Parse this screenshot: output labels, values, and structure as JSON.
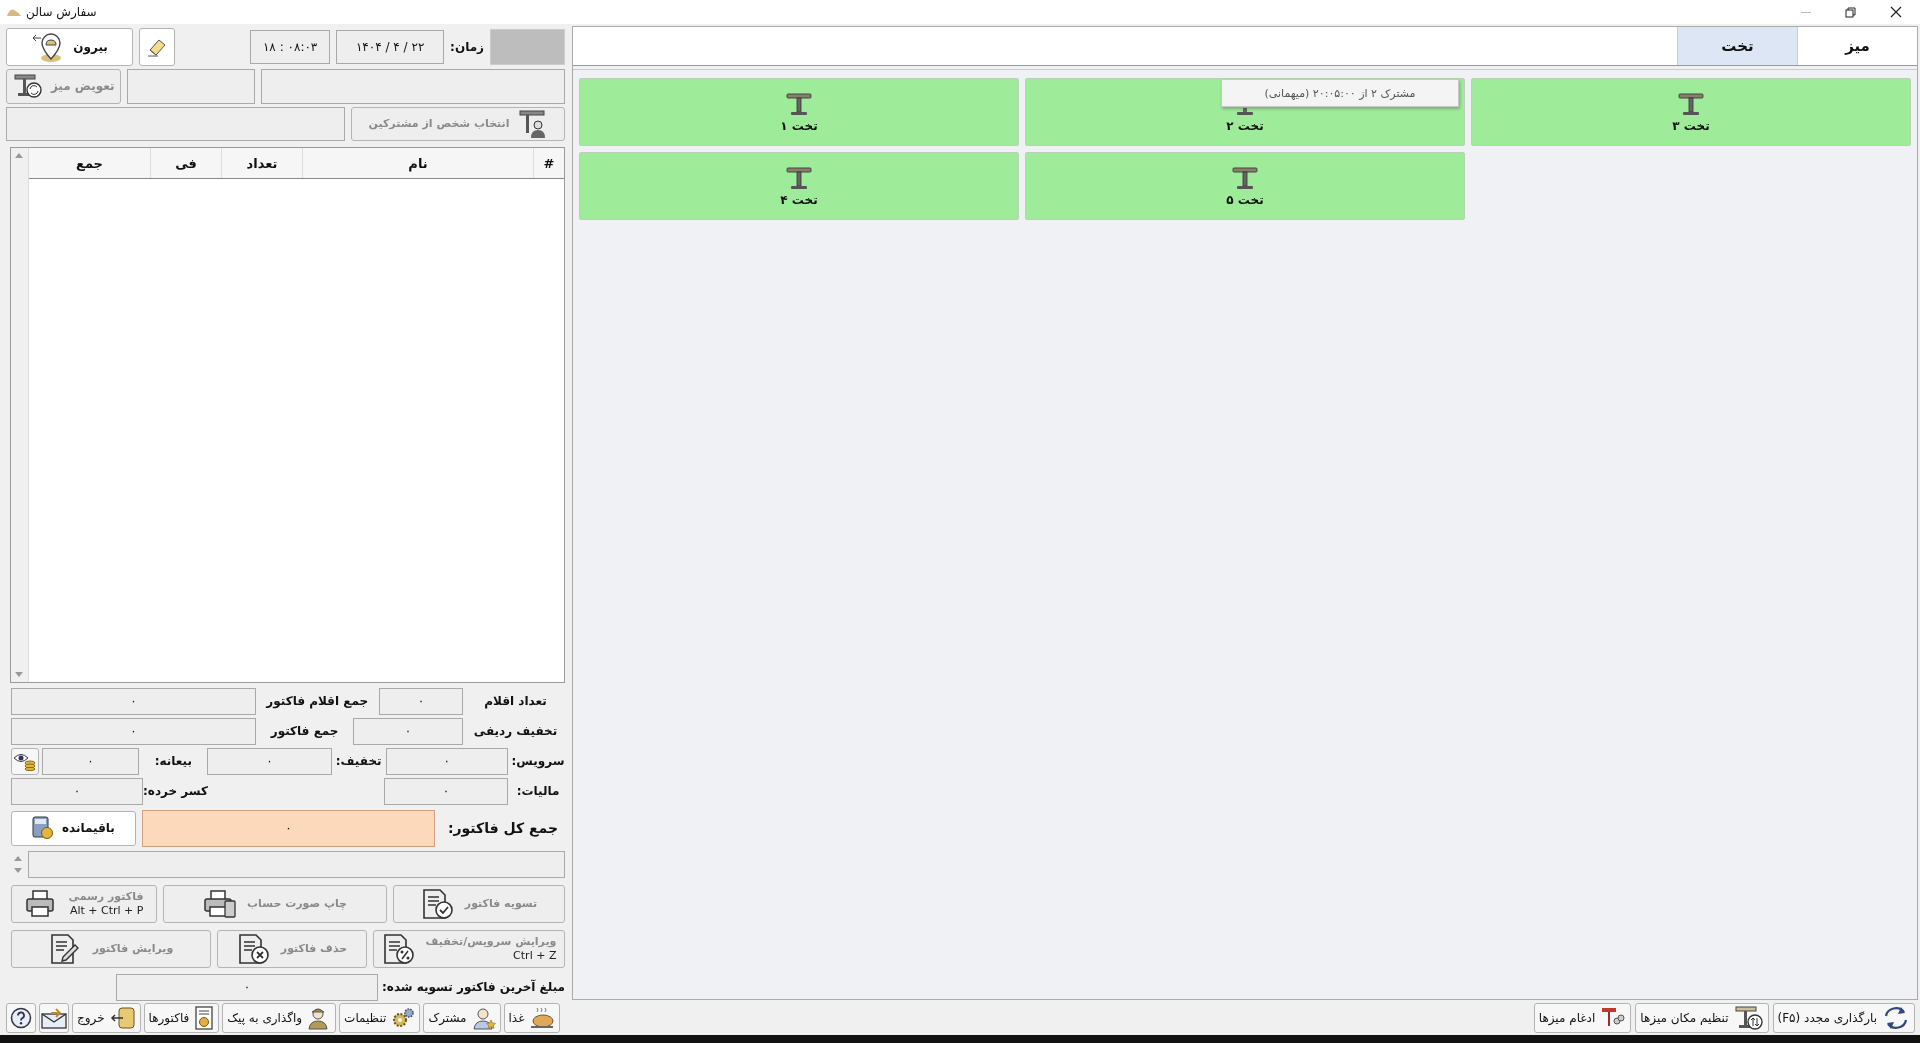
{
  "window": {
    "title": "سفارش سالن"
  },
  "header": {
    "out_button": {
      "label": "بیرون",
      "disabled": false
    },
    "time_label": "زمان:",
    "date": "۱۴۰۴ / ۴ / ۲۲",
    "time": "۱۸ : ۰۸:۰۳"
  },
  "change_table_button": {
    "label": "تعویض میز",
    "disabled": true
  },
  "customer_button": {
    "label": "انتخاب شخص از مشترکین",
    "disabled": true
  },
  "order_table": {
    "columns": [
      "#",
      "نام",
      "تعداد",
      "فی",
      "جمع"
    ]
  },
  "summary": [
    [
      {
        "kind": "label",
        "text": "تعداد اقلام"
      },
      {
        "kind": "field",
        "value": "۰"
      },
      {
        "kind": "label",
        "text": "جمع اقلام فاکتور"
      },
      {
        "kind": "field",
        "value": "۰"
      }
    ],
    [
      {
        "kind": "label",
        "text": "تخفیف ردیفی"
      },
      {
        "kind": "field",
        "value": "۰"
      },
      {
        "kind": "label",
        "text": "جمع فاکتور"
      },
      {
        "kind": "field",
        "value": "۰"
      }
    ],
    [
      {
        "kind": "label",
        "text": "سرویس:"
      },
      {
        "kind": "field",
        "value": "۰"
      },
      {
        "kind": "label",
        "text": "تخفیف:"
      },
      {
        "kind": "field",
        "value": "۰"
      },
      {
        "kind": "label",
        "text": "بیعانه:"
      },
      {
        "kind": "field",
        "value": "۰"
      },
      {
        "kind": "icon-button"
      }
    ],
    [
      {
        "kind": "label",
        "text": "مالیات:"
      },
      {
        "kind": "field",
        "value": "۰"
      },
      {
        "kind": "label",
        "text": "کسر خرده:"
      },
      {
        "kind": "field",
        "value": "۰"
      }
    ]
  ],
  "total": {
    "label": "جمع کل فاکتور:",
    "value": "۰",
    "remaining_button": {
      "label": "باقیمانده",
      "disabled": false
    }
  },
  "actions": [
    {
      "label": "تسویه فاکتور",
      "disabled": true
    },
    {
      "label": "چاپ صورت حساب",
      "disabled": true
    },
    {
      "label": "فاکتور رسمی",
      "shortcut": "Alt + Ctrl + P",
      "disabled": true
    },
    {
      "label": "ویرایش سرویس/تخفیف",
      "shortcut": "Ctrl + Z",
      "disabled": true
    },
    {
      "label": "حذف فاکتور",
      "disabled": true
    },
    {
      "label": "ویرایش فاکتور",
      "disabled": true
    }
  ],
  "last_settled": {
    "label": "مبلغ آخرین فاکتور تسویه شده:",
    "value": "۰"
  },
  "tabs": [
    {
      "label": "میز",
      "selected": false
    },
    {
      "label": "تخت",
      "selected": true
    }
  ],
  "tiles": [
    {
      "label": "تخت ۳"
    },
    {
      "label": "تخت ۲",
      "tooltip": "مشترک ۲ از ۲۰:۰۵:۰۰ (میهمانی)"
    },
    {
      "label": "تخت ۱"
    },
    {
      "label": "تخت ۵"
    },
    {
      "label": "تخت ۴"
    }
  ],
  "bottom_left": [
    {
      "label": "غذا"
    },
    {
      "label": "مشترک"
    },
    {
      "label": "تنظیمات"
    },
    {
      "label": "واگذاری به پیک"
    },
    {
      "label": "فاکتورها"
    },
    {
      "label": "خروج"
    }
  ],
  "bottom_right": [
    {
      "label": "بارگذاری مجدد (F۵)"
    },
    {
      "label": "تنظیم مکان میزها"
    },
    {
      "label": "ادغام میزها"
    }
  ]
}
